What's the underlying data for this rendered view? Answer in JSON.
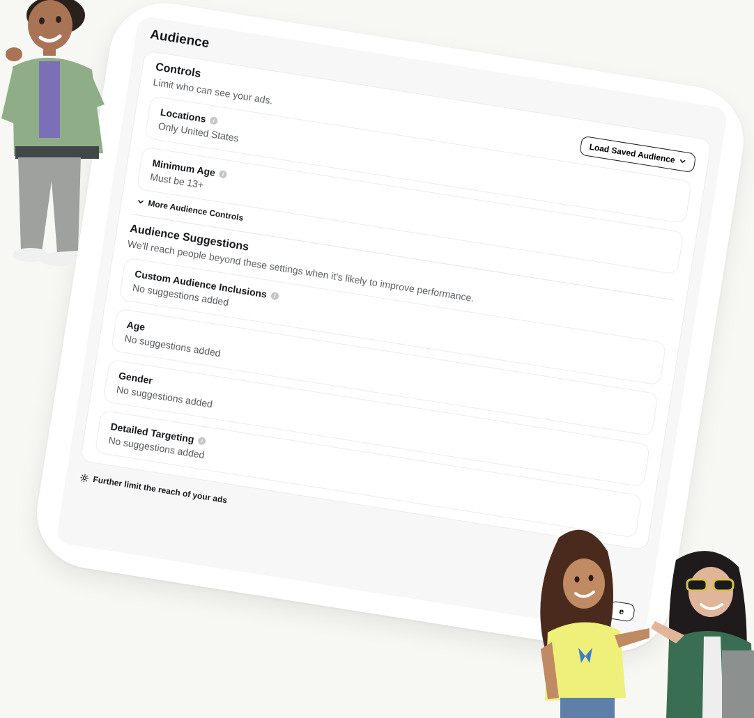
{
  "section": {
    "title": "Audience"
  },
  "controls": {
    "title": "Controls",
    "subtitle": "Limit who can see your ads.",
    "load_saved_label": "Load Saved Audience",
    "items": [
      {
        "title": "Locations",
        "value": "Only United States"
      },
      {
        "title": "Minimum Age",
        "value": "Must be 13+"
      }
    ],
    "more_label": "More Audience Controls"
  },
  "suggestions": {
    "title": "Audience Suggestions",
    "subtitle": "We'll reach people beyond these settings when it's likely to improve performance.",
    "items": [
      {
        "title": "Custom Audience Inclusions",
        "value": "No suggestions added"
      },
      {
        "title": "Age",
        "value": "No suggestions added"
      },
      {
        "title": "Gender",
        "value": "No suggestions added"
      },
      {
        "title": "Detailed Targeting",
        "value": "No suggestions added"
      }
    ]
  },
  "footer": {
    "further_label": "Further limit the reach of your ads",
    "cta_label": "e"
  },
  "icons": {
    "info": "info-icon",
    "chevron": "chevron-down-icon",
    "gear": "gear-icon"
  },
  "colors": {
    "background": "#f7f8f3",
    "card": "#ffffff",
    "panel": "#f7f7f7",
    "text": "#16191c",
    "muted": "#5b5f63"
  }
}
